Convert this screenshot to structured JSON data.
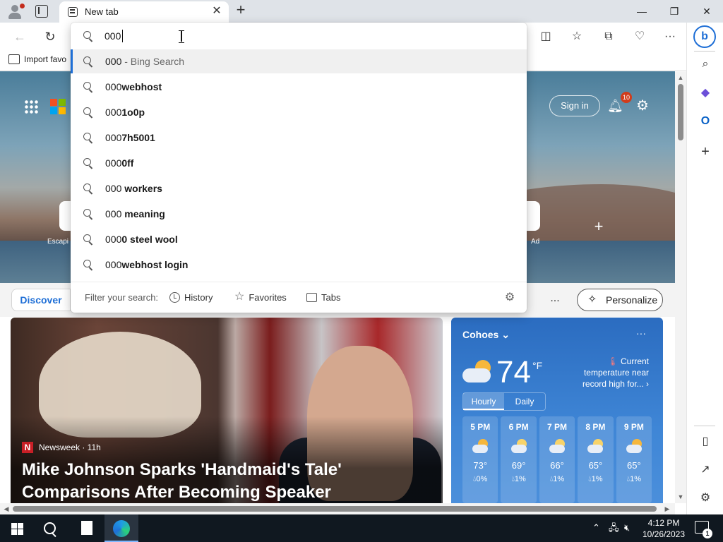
{
  "browser": {
    "tab_title": "New tab",
    "favorites_bar": {
      "import_label": "Import favo"
    },
    "icons": [
      "profile-icon",
      "tab-actions-icon",
      "tab-favicon-icon",
      "close-icon",
      "plus-icon",
      "minimize-icon",
      "restore-icon",
      "close-window-icon",
      "back-icon",
      "refresh-icon",
      "split-screen-icon",
      "favorites-icon",
      "collections-icon",
      "browser-essentials-icon",
      "more-icon"
    ]
  },
  "omnibox": {
    "query": "000",
    "suggestions": [
      {
        "prefix": "000",
        "bold": "",
        "suffix": " - Bing Search"
      },
      {
        "prefix": "000",
        "bold": "webhost",
        "suffix": ""
      },
      {
        "prefix": "000",
        "bold": "1o0p",
        "suffix": ""
      },
      {
        "prefix": "000",
        "bold": "7h5001",
        "suffix": ""
      },
      {
        "prefix": "000",
        "bold": "0ff",
        "suffix": ""
      },
      {
        "prefix": "000",
        "bold": " workers",
        "suffix": ""
      },
      {
        "prefix": "000",
        "bold": " meaning",
        "suffix": ""
      },
      {
        "prefix": "000",
        "bold": "0 steel wool",
        "suffix": ""
      },
      {
        "prefix": "000",
        "bold": "webhost login",
        "suffix": ""
      }
    ],
    "filter_label": "Filter your search:",
    "filters": {
      "history": "History",
      "favorites": "Favorites",
      "tabs": "Tabs"
    }
  },
  "newtab": {
    "signin": "Sign in",
    "notifications_count": "10",
    "quicklinks": {
      "left_label": "Escapi",
      "right_label": "Ad"
    },
    "feed": {
      "discover": "Discover",
      "more": "...",
      "personalize": "Personalize"
    },
    "news": {
      "source": "Newsweek · 11h",
      "source_logo": "N",
      "title": "Mike Johnson Sparks 'Handmaid's Tale' Comparisons After Becoming Speaker"
    },
    "weather": {
      "city": "Cohoes",
      "more": "···",
      "temp": "74",
      "unit": "°F",
      "note": "Current temperature near record high for...",
      "tabs": [
        "Hourly",
        "Daily"
      ],
      "hours": [
        {
          "time": "5 PM",
          "temp": "73°",
          "precip": "0%",
          "icon": "partly-cloudy-icon"
        },
        {
          "time": "6 PM",
          "temp": "69°",
          "precip": "1%",
          "icon": "cloudy-moon-icon"
        },
        {
          "time": "7 PM",
          "temp": "66°",
          "precip": "1%",
          "icon": "cloudy-moon-icon"
        },
        {
          "time": "8 PM",
          "temp": "65°",
          "precip": "1%",
          "icon": "cloudy-moon-icon"
        },
        {
          "time": "9 PM",
          "temp": "65°",
          "precip": "1%",
          "icon": "partly-cloudy-icon"
        }
      ]
    }
  },
  "taskbar": {
    "time": "4:12 PM",
    "date": "10/26/2023",
    "notification_count": "1"
  },
  "colors": {
    "accent": "#1f6fd6",
    "weather_bg": "#3f86d6",
    "taskbar": "#101820"
  }
}
